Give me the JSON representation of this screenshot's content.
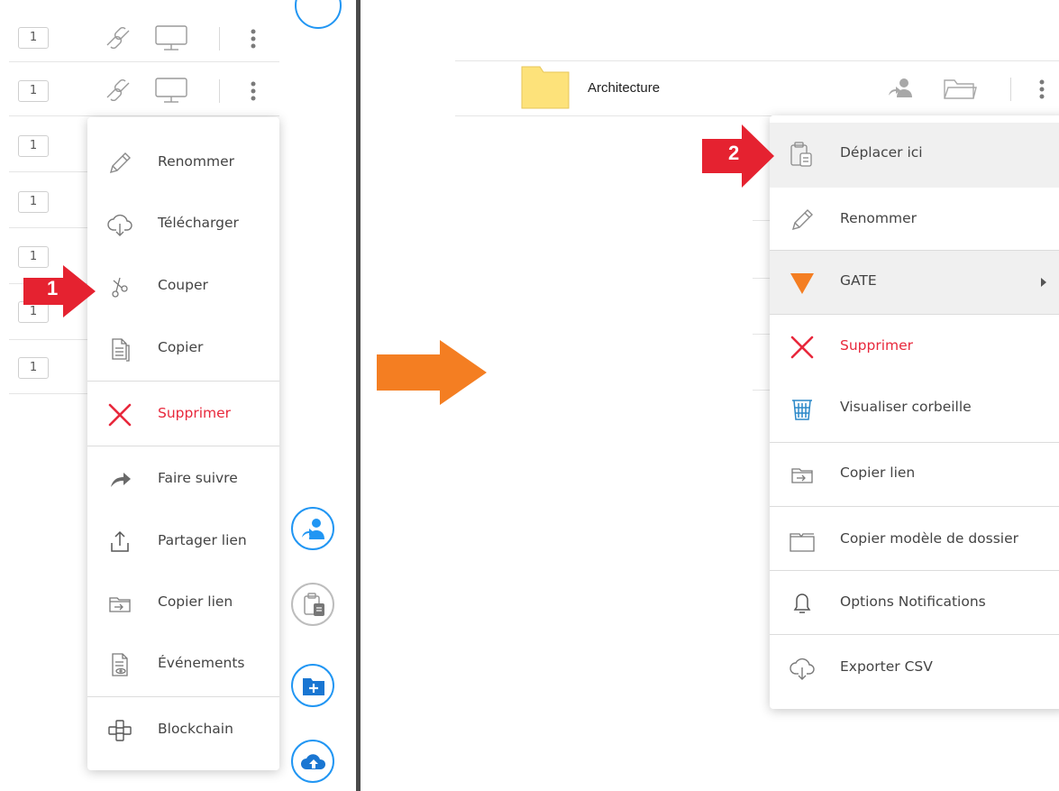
{
  "left_panel": {
    "rows": [
      {
        "count": "1"
      },
      {
        "count": "1"
      },
      {
        "count": "1"
      },
      {
        "count": "1"
      },
      {
        "count": "1"
      },
      {
        "count": "1"
      },
      {
        "count": "1"
      }
    ],
    "context_menu": {
      "items": [
        {
          "label": "Renommer",
          "icon": "pencil-icon"
        },
        {
          "label": "Télécharger",
          "icon": "cloud-download-icon"
        },
        {
          "label": "Couper",
          "icon": "scissors-icon"
        },
        {
          "label": "Copier",
          "icon": "copy-icon"
        },
        {
          "label": "Supprimer",
          "icon": "delete-x-icon",
          "color": "#e8283c"
        },
        {
          "label": "Faire suivre",
          "icon": "forward-arrow-icon"
        },
        {
          "label": "Partager lien",
          "icon": "share-upload-icon"
        },
        {
          "label": "Copier lien",
          "icon": "folder-link-icon"
        },
        {
          "label": "Événements",
          "icon": "document-eye-icon"
        },
        {
          "label": "Blockchain",
          "icon": "blockchain-icon"
        }
      ]
    },
    "step_marker": {
      "number": "1",
      "color": "#e52230"
    }
  },
  "fab_buttons": [
    {
      "icon": "share-user-icon"
    },
    {
      "icon": "paste-clipboard-icon"
    },
    {
      "icon": "new-folder-icon"
    },
    {
      "icon": "cloud-upload-icon"
    }
  ],
  "transition_arrow": {
    "color": "#f47e22"
  },
  "right_panel": {
    "folder": {
      "name": "Architecture",
      "color": "#fde27a"
    },
    "context_menu": {
      "items": [
        {
          "label": "Déplacer ici",
          "icon": "paste-clipboard-icon",
          "highlighted": true
        },
        {
          "label": "Renommer",
          "icon": "pencil-icon"
        },
        {
          "label": "GATE",
          "icon": "gate-triangle-icon",
          "submenu": true,
          "highlighted": true,
          "color": "#f47e22"
        },
        {
          "label": "Supprimer",
          "icon": "delete-x-icon",
          "color": "#e8283c"
        },
        {
          "label": "Visualiser corbeille",
          "icon": "trash-icon"
        },
        {
          "label": "Copier lien",
          "icon": "folder-link-icon"
        },
        {
          "label": "Copier modèle de dossier",
          "icon": "folder-icon"
        },
        {
          "label": "Options Notifications",
          "icon": "bell-icon"
        },
        {
          "label": "Exporter CSV",
          "icon": "cloud-download-icon"
        }
      ]
    },
    "step_marker": {
      "number": "2",
      "color": "#e52230"
    }
  }
}
